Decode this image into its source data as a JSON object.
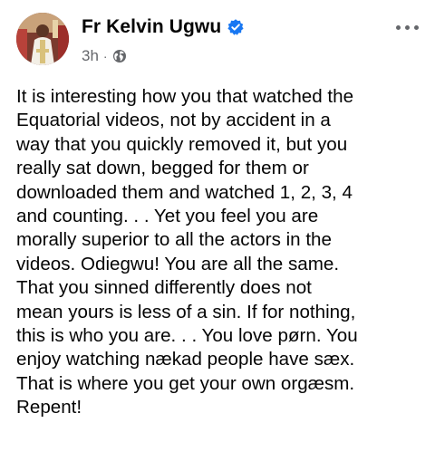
{
  "post": {
    "author": "Fr Kelvin Ugwu",
    "verified_icon": "verified-badge-icon",
    "time": "3h",
    "separator": "·",
    "audience_icon": "globe-icon",
    "more_icon": "more-options-icon",
    "text": "It is interesting how you that watched the\nEquatorial videos, not by accident in a\nway that you quickly removed it, but you\nreally sat down, begged for them or\ndownloaded them and watched 1, 2, 3, 4\nand counting. . . Yet you feel you are\nmorally superior to all the actors in the\nvideos. Odiegwu! You are all the same.\nThat you sinned differently does not\nmean yours is less of a sin. If for nothing,\nthis is who you are. . . You love pørn. You\nenjoy watching nækad people have sæx.\nThat is where you get your own orgæsm.\nRepent!"
  },
  "colors": {
    "verified_blue": "#1877f2",
    "meta_gray": "#65676b",
    "text_black": "#050505"
  }
}
